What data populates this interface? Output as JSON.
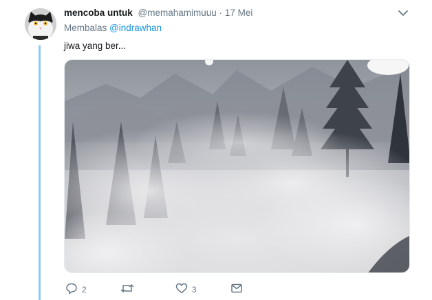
{
  "tweet": {
    "author_name": "mencoba untuk",
    "author_handle": "@memahamimuuu",
    "separator": "·",
    "timestamp": "17 Mei",
    "reply_prefix": "Membalas",
    "reply_mention": "@indrawhan",
    "text": "jiwa yang ber...",
    "media_description": "foggy pine forest"
  },
  "actions": {
    "reply_count": "2",
    "retweet_count": "",
    "like_count": "3"
  },
  "colors": {
    "link": "#1b95e0",
    "muted": "#657786",
    "thread_line": "#8ec9f0",
    "text": "#14171a"
  },
  "icons": {
    "more": "chevron-down-icon",
    "reply": "reply-icon",
    "retweet": "retweet-icon",
    "like": "heart-icon",
    "dm": "envelope-icon"
  }
}
